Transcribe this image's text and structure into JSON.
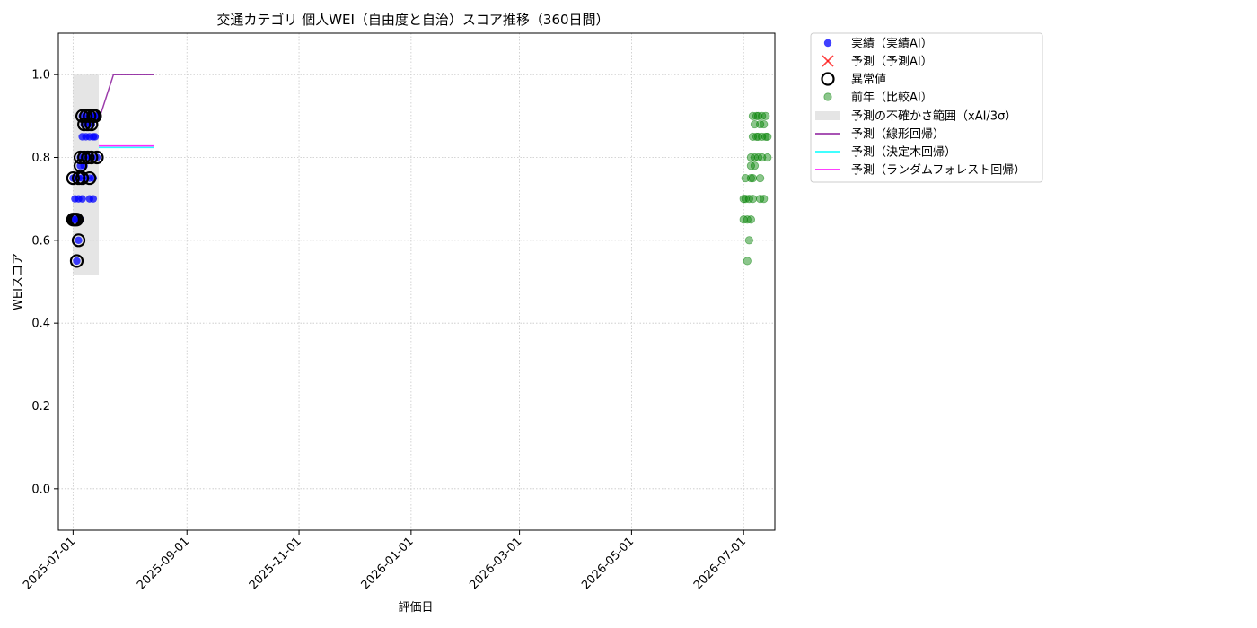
{
  "chart_data": {
    "type": "scatter",
    "title": "交通カテゴリ 個人WEI（自由度と自治）スコア推移（360日間）",
    "xlabel": "評価日",
    "ylabel": "WEIスコア",
    "xlim": [
      "2025-06-23",
      "2026-07-18"
    ],
    "ylim": [
      -0.1,
      1.1
    ],
    "x_ticks": [
      "2025-07-01",
      "2025-09-01",
      "2025-11-01",
      "2026-01-01",
      "2026-03-01",
      "2026-05-01",
      "2026-07-01"
    ],
    "y_ticks": [
      0.0,
      0.2,
      0.4,
      0.6,
      0.8,
      1.0
    ],
    "y_tick_labels": [
      "0.0",
      "0.2",
      "0.4",
      "0.6",
      "0.8",
      "1.0"
    ],
    "grid": true,
    "legend_position": "outside-top-right",
    "colors": {
      "actual": "#0000ff",
      "forecast": "#ff0000",
      "anomaly": "#000000",
      "previous_year": "#008000",
      "band": "#d3d3d3",
      "linear": "#8b1a9b",
      "tree": "#00ffff",
      "forest": "#ff00ff"
    },
    "series": [
      {
        "name": "実績（実績AI）",
        "kind": "scatter",
        "points": [
          [
            "2025-07-01",
            0.65
          ],
          [
            "2025-07-01",
            0.75
          ],
          [
            "2025-07-02",
            0.7
          ],
          [
            "2025-07-02",
            0.65
          ],
          [
            "2025-07-03",
            0.75
          ],
          [
            "2025-07-03",
            0.55
          ],
          [
            "2025-07-03",
            0.65
          ],
          [
            "2025-07-04",
            0.6
          ],
          [
            "2025-07-04",
            0.7
          ],
          [
            "2025-07-04",
            0.75
          ],
          [
            "2025-07-05",
            0.78
          ],
          [
            "2025-07-05",
            0.65
          ],
          [
            "2025-07-05",
            0.8
          ],
          [
            "2025-07-06",
            0.9
          ],
          [
            "2025-07-06",
            0.85
          ],
          [
            "2025-07-06",
            0.75
          ],
          [
            "2025-07-06",
            0.7
          ],
          [
            "2025-07-07",
            0.78
          ],
          [
            "2025-07-07",
            0.88
          ],
          [
            "2025-07-07",
            0.8
          ],
          [
            "2025-07-08",
            0.9
          ],
          [
            "2025-07-08",
            0.75
          ],
          [
            "2025-07-08",
            0.85
          ],
          [
            "2025-07-09",
            0.8
          ],
          [
            "2025-07-09",
            0.88
          ],
          [
            "2025-07-10",
            0.9
          ],
          [
            "2025-07-10",
            0.7
          ],
          [
            "2025-07-10",
            0.85
          ],
          [
            "2025-07-10",
            0.75
          ],
          [
            "2025-07-11",
            0.8
          ],
          [
            "2025-07-11",
            0.9
          ],
          [
            "2025-07-11",
            0.88
          ],
          [
            "2025-07-12",
            0.7
          ],
          [
            "2025-07-12",
            0.85
          ],
          [
            "2025-07-12",
            0.75
          ],
          [
            "2025-07-13",
            0.9
          ],
          [
            "2025-07-13",
            0.85
          ],
          [
            "2025-07-14",
            0.8
          ],
          [
            "2025-07-14",
            0.9
          ]
        ]
      },
      {
        "name": "予測（予測AI）",
        "kind": "scatter",
        "points": []
      },
      {
        "name": "異常値",
        "kind": "scatter",
        "points": [
          [
            "2025-07-01",
            0.65
          ],
          [
            "2025-07-01",
            0.75
          ],
          [
            "2025-07-02",
            0.65
          ],
          [
            "2025-07-03",
            0.55
          ],
          [
            "2025-07-03",
            0.65
          ],
          [
            "2025-07-04",
            0.6
          ],
          [
            "2025-07-04",
            0.75
          ],
          [
            "2025-07-05",
            0.78
          ],
          [
            "2025-07-05",
            0.8
          ],
          [
            "2025-07-06",
            0.9
          ],
          [
            "2025-07-06",
            0.75
          ],
          [
            "2025-07-07",
            0.88
          ],
          [
            "2025-07-07",
            0.8
          ],
          [
            "2025-07-08",
            0.9
          ],
          [
            "2025-07-09",
            0.8
          ],
          [
            "2025-07-09",
            0.88
          ],
          [
            "2025-07-10",
            0.9
          ],
          [
            "2025-07-10",
            0.75
          ],
          [
            "2025-07-11",
            0.88
          ],
          [
            "2025-07-11",
            0.8
          ],
          [
            "2025-07-12",
            0.9
          ],
          [
            "2025-07-13",
            0.9
          ],
          [
            "2025-07-14",
            0.8
          ]
        ]
      },
      {
        "name": "前年（比較AI）",
        "kind": "scatter",
        "points": [
          [
            "2026-07-01",
            0.65
          ],
          [
            "2026-07-01",
            0.7
          ],
          [
            "2026-07-02",
            0.75
          ],
          [
            "2026-07-02",
            0.7
          ],
          [
            "2026-07-03",
            0.65
          ],
          [
            "2026-07-03",
            0.55
          ],
          [
            "2026-07-04",
            0.6
          ],
          [
            "2026-07-04",
            0.7
          ],
          [
            "2026-07-05",
            0.8
          ],
          [
            "2026-07-05",
            0.78
          ],
          [
            "2026-07-05",
            0.65
          ],
          [
            "2026-07-05",
            0.75
          ],
          [
            "2026-07-06",
            0.85
          ],
          [
            "2026-07-06",
            0.9
          ],
          [
            "2026-07-06",
            0.7
          ],
          [
            "2026-07-06",
            0.75
          ],
          [
            "2026-07-07",
            0.78
          ],
          [
            "2026-07-07",
            0.88
          ],
          [
            "2026-07-07",
            0.8
          ],
          [
            "2026-07-08",
            0.85
          ],
          [
            "2026-07-08",
            0.9
          ],
          [
            "2026-07-09",
            0.8
          ],
          [
            "2026-07-09",
            0.9
          ],
          [
            "2026-07-09",
            0.85
          ],
          [
            "2026-07-10",
            0.75
          ],
          [
            "2026-07-10",
            0.88
          ],
          [
            "2026-07-10",
            0.7
          ],
          [
            "2026-07-11",
            0.85
          ],
          [
            "2026-07-11",
            0.8
          ],
          [
            "2026-07-11",
            0.9
          ],
          [
            "2026-07-12",
            0.7
          ],
          [
            "2026-07-12",
            0.88
          ],
          [
            "2026-07-13",
            0.85
          ],
          [
            "2026-07-13",
            0.9
          ],
          [
            "2026-07-14",
            0.8
          ],
          [
            "2026-07-14",
            0.85
          ]
        ]
      },
      {
        "name": "予測の不確かさ範囲（xAI/3σ）",
        "kind": "band",
        "x_range": [
          "2025-07-01",
          "2025-07-15"
        ],
        "y_range": [
          0.517,
          1.0
        ]
      },
      {
        "name": "予測（線形回帰）",
        "kind": "line",
        "points": [
          [
            "2025-07-15",
            0.89
          ],
          [
            "2025-07-23",
            1.0
          ],
          [
            "2025-08-14",
            1.0
          ]
        ]
      },
      {
        "name": "予測（決定木回帰）",
        "kind": "line",
        "points": [
          [
            "2025-07-15",
            0.824
          ],
          [
            "2025-08-14",
            0.824
          ]
        ]
      },
      {
        "name": "予測（ランダムフォレスト回帰）",
        "kind": "line",
        "points": [
          [
            "2025-07-15",
            0.828
          ],
          [
            "2025-08-14",
            0.828
          ]
        ]
      }
    ]
  }
}
